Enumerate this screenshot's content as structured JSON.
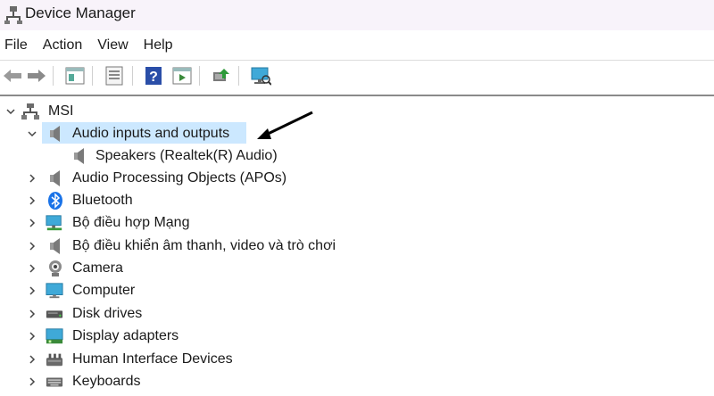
{
  "window": {
    "title": "Device Manager"
  },
  "menu": [
    "File",
    "Action",
    "View",
    "Help"
  ],
  "toolbar": [
    "back-icon",
    "forward-icon",
    "properties-icon",
    "list-icon",
    "help-icon",
    "run-icon",
    "update-driver-icon",
    "scan-hardware-icon"
  ],
  "tree": {
    "root": "MSI",
    "items": [
      {
        "label": "Audio inputs and outputs",
        "icon": "speaker-icon",
        "expanded": true,
        "selected": true,
        "children": [
          {
            "label": "Speakers (Realtek(R) Audio)",
            "icon": "speaker-icon"
          }
        ]
      },
      {
        "label": "Audio Processing Objects (APOs)",
        "icon": "speaker-icon"
      },
      {
        "label": "Bluetooth",
        "icon": "bluetooth-icon"
      },
      {
        "label": "Bộ điều hợp Mạng",
        "icon": "network-adapter-icon"
      },
      {
        "label": "Bộ điều khiển âm thanh, video và trò chơi",
        "icon": "speaker-icon"
      },
      {
        "label": "Camera",
        "icon": "camera-icon"
      },
      {
        "label": "Computer",
        "icon": "computer-icon"
      },
      {
        "label": "Disk drives",
        "icon": "disk-drive-icon"
      },
      {
        "label": "Display adapters",
        "icon": "display-adapter-icon"
      },
      {
        "label": "Human Interface Devices",
        "icon": "hid-icon"
      },
      {
        "label": "Keyboards",
        "icon": "keyboard-icon"
      }
    ]
  },
  "colors": {
    "selection": "#cce8ff",
    "titlebar": "#f8f3fa",
    "accent": "#1a73e8"
  }
}
